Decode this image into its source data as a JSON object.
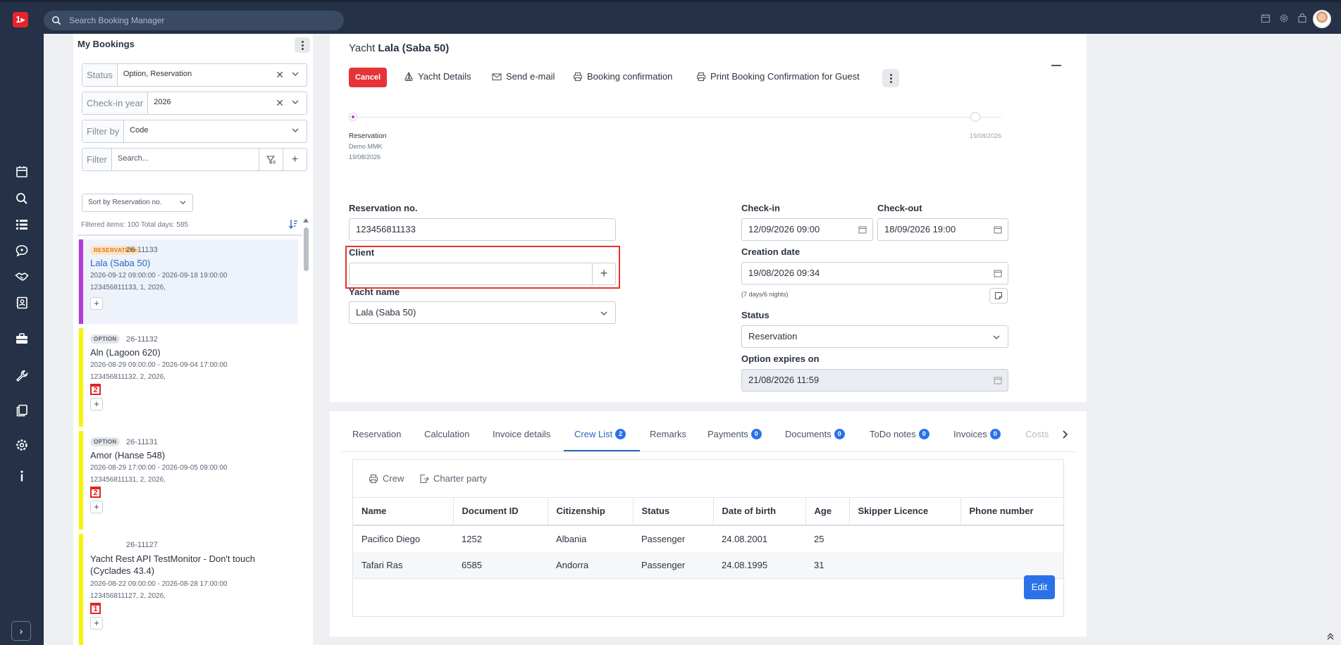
{
  "topbar": {
    "logo_text": "1▸",
    "search_placeholder": "Search Booking Manager"
  },
  "icons": [
    "search-icon",
    "calendar-icon",
    "settings-icon",
    "shopping-bag-icon",
    "calendar-nav-icon",
    "search-nav-icon",
    "list-nav-icon",
    "chat-nav-icon",
    "handshake-nav-icon",
    "contacts-nav-icon",
    "briefcase-nav-icon",
    "wrench-nav-icon",
    "documents-nav-icon",
    "settings-nav-icon",
    "info-nav-icon"
  ],
  "bookings": {
    "title": "My Bookings",
    "filters": {
      "status_label": "Status",
      "status_value": "Option, Reservation",
      "year_label": "Check-in year",
      "year_value": "2026",
      "filterby_label": "Filter by",
      "filterby_value": "Code",
      "filter_label": "Filter",
      "filter_placeholder": "Search..."
    },
    "sort_label": "Sort by Reservation no.",
    "filtered_info": "Filtered items: 100   Total days: 585",
    "cards": [
      {
        "badge": "RESERVATION",
        "code": "26-11133",
        "name": "Lala (Saba 50)",
        "dates": "2026-09-12 09:00:00 - 2026-09-18 19:00:00",
        "meta": "123456811133, 1, 2026,",
        "bar_color": "#b43ad6"
      },
      {
        "badge": "OPTION",
        "code": "26-11132",
        "name": "Aln (Lagoon 620)",
        "dates": "2026-08-29 09:00:00 - 2026-09-04 17:00:00",
        "meta": "123456811132, 2, 2026,",
        "cal": "2",
        "bar_color": "#f5f50a"
      },
      {
        "badge": "OPTION",
        "code": "26-11131",
        "name": "Amor (Hanse 548)",
        "dates": "2026-08-29 17:00:00 - 2026-09-05 09:00:00",
        "meta": "123456811131, 2, 2026,",
        "cal": "2",
        "bar_color": "#f5f50a"
      },
      {
        "badge": "",
        "code": "26-11127",
        "name": "Yacht Rest API TestMonitor - Don't touch (Cyclades 43.4)",
        "dates": "2026-08-22 09:00:00 - 2026-08-28 17:00:00",
        "meta": "123456811127, 2, 2026,",
        "cal": "1",
        "bar_color": "#f5f50a"
      }
    ]
  },
  "detail": {
    "title_prefix": "Yacht",
    "title_name": "Lala (Saba 50)",
    "actions": {
      "cancel": "Cancel",
      "yacht_details": "Yacht Details",
      "send_email": "Send e-mail",
      "booking_confirmation": "Booking confirmation",
      "print_guest": "Print Booking Confirmation for Guest"
    },
    "timeline": {
      "status": "Reservation",
      "user": "Demo MMK",
      "date": "19/08/2026",
      "end_date": "19/08/2026"
    },
    "fields": {
      "reservation_no_label": "Reservation no.",
      "reservation_no": "123456811133",
      "client_label": "Client",
      "client_value": "",
      "yacht_name_label": "Yacht name",
      "yacht_name": "Lala (Saba 50)",
      "checkin_label": "Check-in",
      "checkin": "12/09/2026 09:00",
      "checkout_label": "Check-out",
      "checkout": "18/09/2026 19:00",
      "creation_label": "Creation date",
      "creation": "19/08/2026 09:34",
      "duration_note": "(7 days/6 nights)",
      "status_label": "Status",
      "status": "Reservation",
      "option_expires_label": "Option expires on",
      "option_expires": "21/08/2026 11:59"
    }
  },
  "tabs": [
    {
      "label": "Reservation"
    },
    {
      "label": "Calculation"
    },
    {
      "label": "Invoice details"
    },
    {
      "label": "Crew List",
      "count": "2"
    },
    {
      "label": "Remarks"
    },
    {
      "label": "Payments",
      "count": "0"
    },
    {
      "label": "Documents",
      "count": "0"
    },
    {
      "label": "ToDo notes",
      "count": "0"
    },
    {
      "label": "Invoices",
      "count": "0"
    },
    {
      "label": "Costs"
    }
  ],
  "crew": {
    "actions": {
      "crew": "Crew",
      "charter_party": "Charter party"
    },
    "columns": [
      "Name",
      "Document ID",
      "Citizenship",
      "Status",
      "Date of birth",
      "Age",
      "Skipper Licence",
      "Phone number"
    ],
    "rows": [
      [
        "Pacifico Diego",
        "1252",
        "Albania",
        "Passenger",
        "24.08.2001",
        "25",
        "",
        ""
      ],
      [
        "Tafari Ras",
        "6585",
        "Andorra",
        "Passenger",
        "24.08.1995",
        "31",
        "",
        ""
      ]
    ],
    "edit_label": "Edit"
  }
}
